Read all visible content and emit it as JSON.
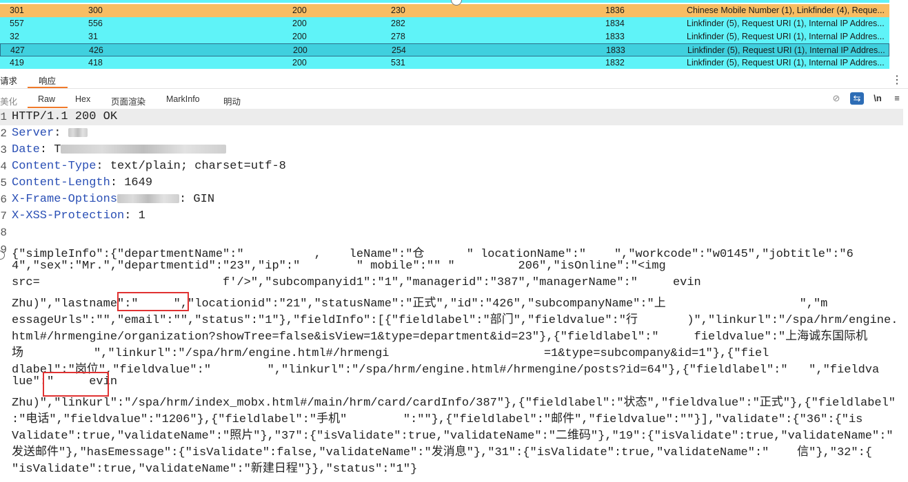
{
  "table": {
    "rows": [
      {
        "c0": "301",
        "c1": "300",
        "c2": "200",
        "c3": "230",
        "c4": "1836",
        "c5": "Chinese Mobile Number (1), Linkfinder (4), Reque...",
        "style": "orange"
      },
      {
        "c0": "557",
        "c1": "556",
        "c2": "200",
        "c3": "282",
        "c4": "1834",
        "c5": "Linkfinder (5), Request URI (1), Internal IP Addres...",
        "style": "cyan"
      },
      {
        "c0": "32",
        "c1": "31",
        "c2": "200",
        "c3": "278",
        "c4": "1833",
        "c5": "Linkfinder (5), Request URI (1), Internal IP Addres...",
        "style": "cyan"
      },
      {
        "c0": "427",
        "c1": "426",
        "c2": "200",
        "c3": "254",
        "c4": "1833",
        "c5": "Linkfinder (5), Request URI (1), Internal IP Addres...",
        "style": "selected"
      },
      {
        "c0": "419",
        "c1": "418",
        "c2": "200",
        "c3": "531",
        "c4": "1832",
        "c5": "Linkfinder (5), Request URI (1), Internal IP Addres...",
        "style": "cyan"
      }
    ]
  },
  "tabs": {
    "request": "请求",
    "response": "响应"
  },
  "view_tabs": {
    "beautify": "美化",
    "raw": "Raw",
    "hex": "Hex",
    "render": "页面渲染",
    "markinfo": "MarkInfo",
    "ming": "明动"
  },
  "toolbar": {
    "newline": "\\n",
    "menu": "≡"
  },
  "headers": [
    {
      "num": "1",
      "key": "HTTP/1.1 200 OK",
      "val": ""
    },
    {
      "num": "2",
      "key": "Server",
      "val": ": "
    },
    {
      "num": "3",
      "key": "Date",
      "val": ": T"
    },
    {
      "num": "4",
      "key": "Content-Type",
      "val": ": text/plain; charset=utf-8"
    },
    {
      "num": "5",
      "key": "Content-Length",
      "val": ": 1649"
    },
    {
      "num": "6",
      "key": "X-Frame-Options",
      "val": ": GIN"
    },
    {
      "num": "7",
      "key": "X-XSS-Protection",
      "val": ": 1"
    },
    {
      "num": "8",
      "key": "",
      "val": ""
    }
  ],
  "body_num": "9",
  "body_lines": [
    "{\"simpleInfo\":{\"departmentName\":\"          ,    leName\":\"仓      \" locationName\":\"    \",\"workcode\":\"w0145\",\"jobtitle\":\"6",
    "4\",\"sex\":\"Mr.\",\"departmentid\":\"23\",\"ip\":\"        \" mobile\":\"\" \"         206\",\"isOnline\":\"<img",
    "src=                          f'/>\",\"subcompanyid1\":\"1\",\"managerid\":\"387\",\"managerName\":\"     evin",
    "Zhu)\",\"lastname\":\"     \",\"locationid\":\"21\",\"statusName\":\"正式\",\"id\":\"426\",\"subcompanyName\":\"上                   \",\"m",
    "essageUrls\":\"\",\"email\":\"\",\"status\":\"1\"},\"fieldInfo\":[{\"fieldlabel\":\"部门\",\"fieldvalue\":\"行       )\",\"linkurl\":\"/spa/hrm/engine.",
    "html#/hrmengine/organization?showTree=false&isView=1&type=department&id=23\"},{\"fieldlabel\":\"     fieldvalue\":\"上海诚东国际机",
    "场          \",\"linkurl\":\"/spa/hrm/engine.html#/hrmengi                      =1&type=subcompany&id=1\"},{\"fiel",
    "dlabel\":\"岗位\",\"fieldvalue\":\"        \",\"linkurl\":\"/spa/hrm/engine.html#/hrmengine/posts?id=64\"},{\"fieldlabel\":\"   \",\"fieldva",
    "lue\":\"     evin",
    "Zhu)\",\"linkurl\":\"/spa/hrm/index_mobx.html#/main/hrm/card/cardInfo/387\"},{\"fieldlabel\":\"状态\",\"fieldvalue\":\"正式\"},{\"fieldlabel\"",
    ":\"电话\",\"fieldvalue\":\"1206\"},{\"fieldlabel\":\"手机\"        \":\"\"},{\"fieldlabel\":\"邮件\",\"fieldvalue\":\"\"}],\"validate\":{\"36\":{\"is",
    "Validate\":true,\"validateName\":\"照片\"},\"37\":{\"isValidate\":true,\"validateName\":\"二维码\"},\"19\":{\"isValidate\":true,\"validateName\":\"",
    "发送邮件\"},\"hasEmessage\":{\"isValidate\":false,\"validateName\":\"发消息\"},\"31\":{\"isValidate\":true,\"validateName\":\"    信\"},\"32\":{",
    "\"isValidate\":true,\"validateName\":\"新建日程\"}},\"status\":\"1\"}"
  ]
}
